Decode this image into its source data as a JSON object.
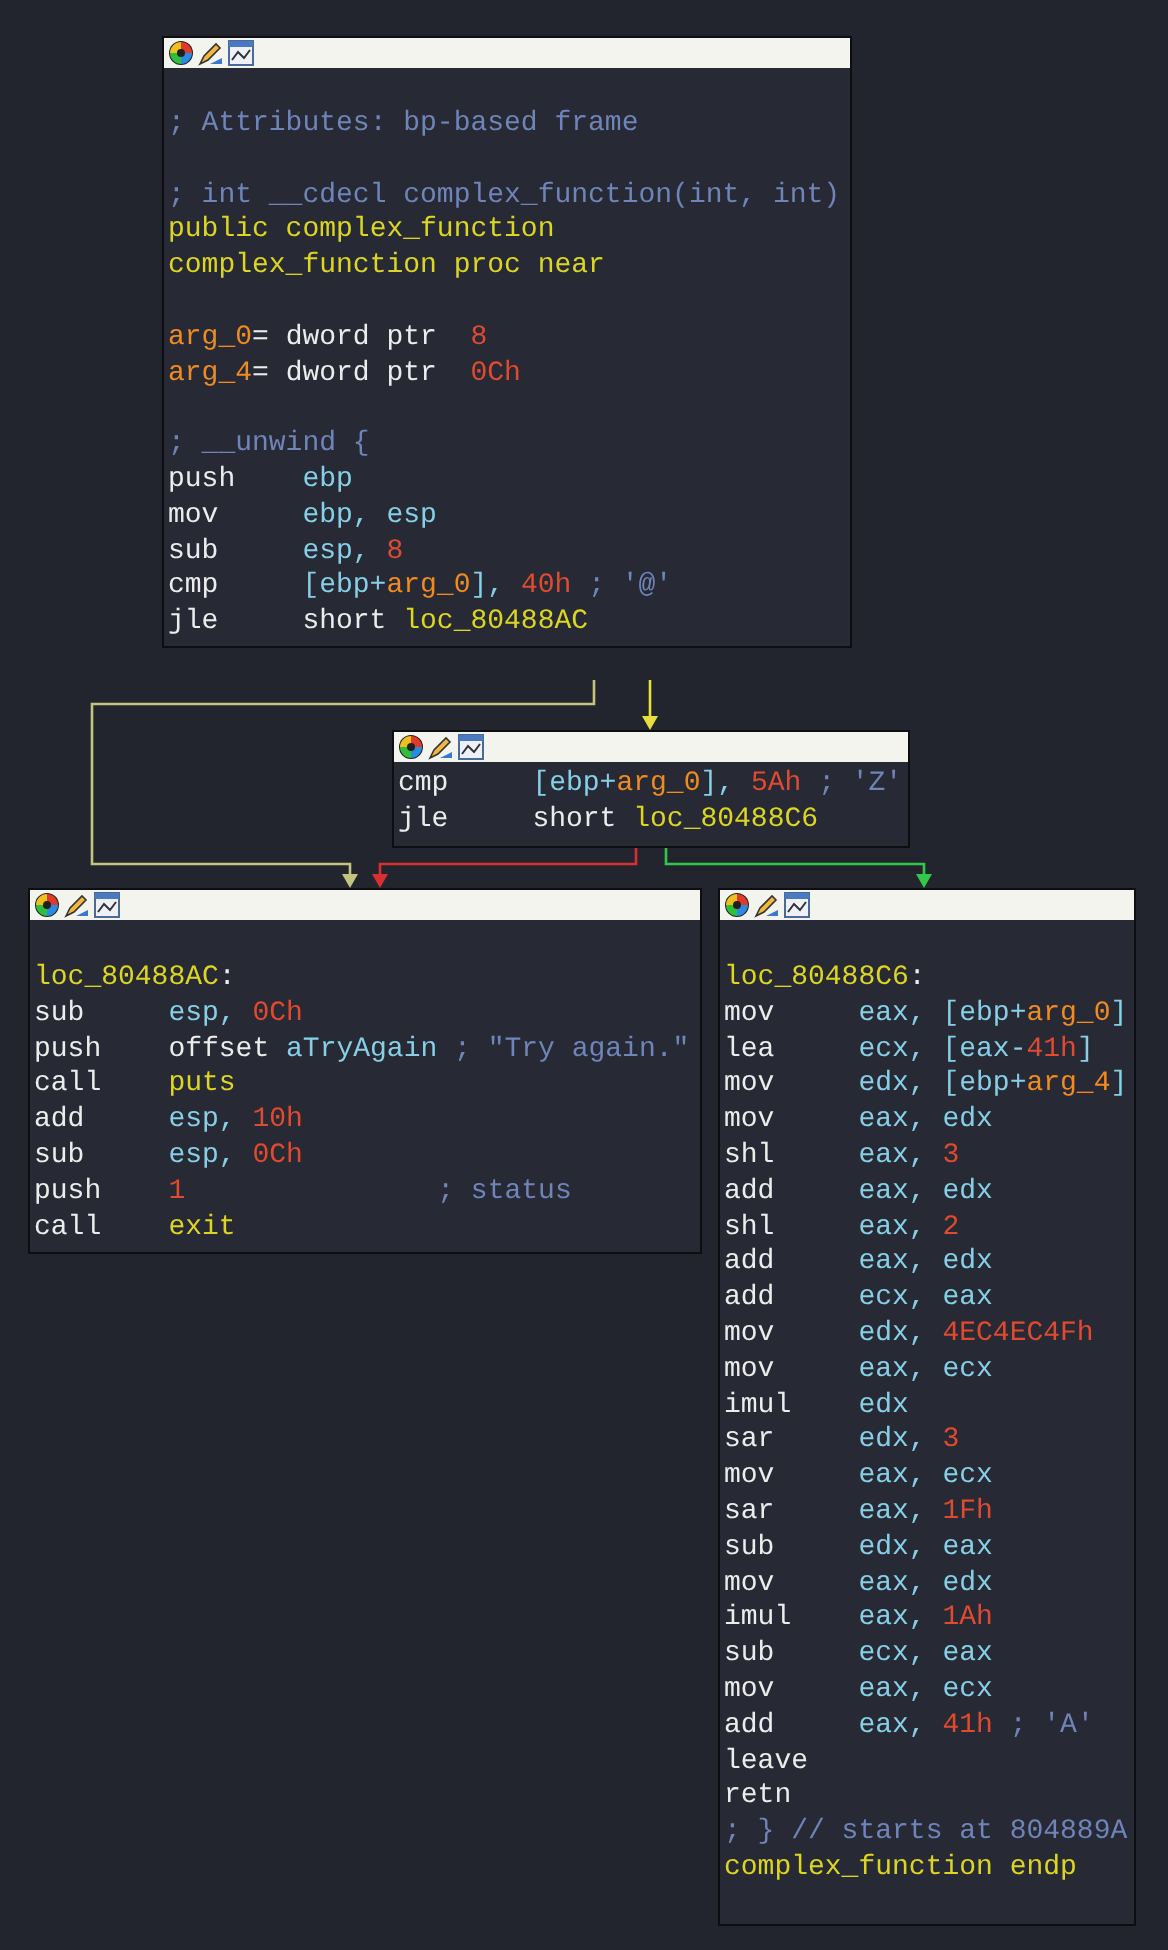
{
  "blocks": [
    {
      "sections": [
        [
          [
            {
              "kind": "comment",
              "text": "; Attributes: bp-based frame"
            }
          ]
        ],
        [
          [
            {
              "kind": "comment",
              "text": "; int __cdecl complex_function(int, int)"
            }
          ],
          [
            {
              "kind": "name",
              "text": "public complex_function"
            }
          ],
          [
            {
              "kind": "name",
              "text": "complex_function proc near"
            }
          ]
        ],
        [
          [
            {
              "kind": "var",
              "text": "arg_0"
            },
            {
              "kind": "plain",
              "text": "= dword ptr  "
            },
            {
              "kind": "number",
              "text": "8"
            }
          ],
          [
            {
              "kind": "var",
              "text": "arg_4"
            },
            {
              "kind": "plain",
              "text": "= dword ptr  "
            },
            {
              "kind": "number",
              "text": "0Ch"
            }
          ]
        ],
        [
          [
            {
              "kind": "comment",
              "text": "; __unwind {"
            }
          ],
          [
            {
              "kind": "mnemonic",
              "text": "push"
            },
            {
              "kind": "register",
              "text": "ebp"
            }
          ],
          [
            {
              "kind": "mnemonic",
              "text": "mov"
            },
            {
              "kind": "register",
              "text": "ebp, esp"
            }
          ],
          [
            {
              "kind": "mnemonic",
              "text": "sub"
            },
            {
              "kind": "register",
              "text": "esp, "
            },
            {
              "kind": "number",
              "text": "8"
            }
          ],
          [
            {
              "kind": "mnemonic",
              "text": "cmp"
            },
            {
              "kind": "register",
              "text": "[ebp+"
            },
            {
              "kind": "var",
              "text": "arg_0"
            },
            {
              "kind": "register",
              "text": "], "
            },
            {
              "kind": "number",
              "text": "40h"
            },
            {
              "kind": "comment",
              "text": " ; '@'"
            }
          ],
          [
            {
              "kind": "mnemonic",
              "text": "jle"
            },
            {
              "kind": "plain",
              "text": "short "
            },
            {
              "kind": "name",
              "text": "loc_80488AC"
            }
          ]
        ]
      ]
    },
    {
      "sections": [
        [
          [
            {
              "kind": "mnemonic",
              "text": "cmp"
            },
            {
              "kind": "register",
              "text": "[ebp+"
            },
            {
              "kind": "var",
              "text": "arg_0"
            },
            {
              "kind": "register",
              "text": "], "
            },
            {
              "kind": "number",
              "text": "5Ah"
            },
            {
              "kind": "comment",
              "text": " ; 'Z'"
            }
          ],
          [
            {
              "kind": "mnemonic",
              "text": "jle"
            },
            {
              "kind": "plain",
              "text": "short "
            },
            {
              "kind": "name",
              "text": "loc_80488C6"
            }
          ]
        ]
      ]
    },
    {
      "sections": [
        [
          [
            {
              "kind": "name",
              "text": "loc_80488AC"
            },
            {
              "kind": "plain",
              "text": ":"
            }
          ],
          [
            {
              "kind": "mnemonic",
              "text": "sub"
            },
            {
              "kind": "register",
              "text": "esp, "
            },
            {
              "kind": "number",
              "text": "0Ch"
            }
          ],
          [
            {
              "kind": "mnemonic",
              "text": "push"
            },
            {
              "kind": "plain",
              "text": "offset "
            },
            {
              "kind": "register",
              "text": "aTryAgain"
            },
            {
              "kind": "comment",
              "text": " ; \"Try again.\""
            }
          ],
          [
            {
              "kind": "mnemonic",
              "text": "call"
            },
            {
              "kind": "name",
              "text": "puts"
            }
          ],
          [
            {
              "kind": "mnemonic",
              "text": "add"
            },
            {
              "kind": "register",
              "text": "esp, "
            },
            {
              "kind": "number",
              "text": "10h"
            }
          ],
          [
            {
              "kind": "mnemonic",
              "text": "sub"
            },
            {
              "kind": "register",
              "text": "esp, "
            },
            {
              "kind": "number",
              "text": "0Ch"
            }
          ],
          [
            {
              "kind": "mnemonic",
              "text": "push"
            },
            {
              "kind": "number",
              "text": "1"
            },
            {
              "kind": "comment",
              "text": "               ; status"
            }
          ],
          [
            {
              "kind": "mnemonic",
              "text": "call"
            },
            {
              "kind": "name",
              "text": "exit"
            }
          ]
        ]
      ]
    },
    {
      "sections": [
        [
          [
            {
              "kind": "name",
              "text": "loc_80488C6"
            },
            {
              "kind": "plain",
              "text": ":"
            }
          ],
          [
            {
              "kind": "mnemonic",
              "text": "mov"
            },
            {
              "kind": "register",
              "text": "eax, [ebp+"
            },
            {
              "kind": "var",
              "text": "arg_0"
            },
            {
              "kind": "register",
              "text": "]"
            }
          ],
          [
            {
              "kind": "mnemonic",
              "text": "lea"
            },
            {
              "kind": "register",
              "text": "ecx, [eax-"
            },
            {
              "kind": "number",
              "text": "41h"
            },
            {
              "kind": "register",
              "text": "]"
            }
          ],
          [
            {
              "kind": "mnemonic",
              "text": "mov"
            },
            {
              "kind": "register",
              "text": "edx, [ebp+"
            },
            {
              "kind": "var",
              "text": "arg_4"
            },
            {
              "kind": "register",
              "text": "]"
            }
          ],
          [
            {
              "kind": "mnemonic",
              "text": "mov"
            },
            {
              "kind": "register",
              "text": "eax, edx"
            }
          ],
          [
            {
              "kind": "mnemonic",
              "text": "shl"
            },
            {
              "kind": "register",
              "text": "eax, "
            },
            {
              "kind": "number",
              "text": "3"
            }
          ],
          [
            {
              "kind": "mnemonic",
              "text": "add"
            },
            {
              "kind": "register",
              "text": "eax, edx"
            }
          ],
          [
            {
              "kind": "mnemonic",
              "text": "shl"
            },
            {
              "kind": "register",
              "text": "eax, "
            },
            {
              "kind": "number",
              "text": "2"
            }
          ],
          [
            {
              "kind": "mnemonic",
              "text": "add"
            },
            {
              "kind": "register",
              "text": "eax, edx"
            }
          ],
          [
            {
              "kind": "mnemonic",
              "text": "add"
            },
            {
              "kind": "register",
              "text": "ecx, eax"
            }
          ],
          [
            {
              "kind": "mnemonic",
              "text": "mov"
            },
            {
              "kind": "register",
              "text": "edx, "
            },
            {
              "kind": "number",
              "text": "4EC4EC4Fh"
            }
          ],
          [
            {
              "kind": "mnemonic",
              "text": "mov"
            },
            {
              "kind": "register",
              "text": "eax, ecx"
            }
          ],
          [
            {
              "kind": "mnemonic",
              "text": "imul"
            },
            {
              "kind": "register",
              "text": "edx"
            }
          ],
          [
            {
              "kind": "mnemonic",
              "text": "sar"
            },
            {
              "kind": "register",
              "text": "edx, "
            },
            {
              "kind": "number",
              "text": "3"
            }
          ],
          [
            {
              "kind": "mnemonic",
              "text": "mov"
            },
            {
              "kind": "register",
              "text": "eax, ecx"
            }
          ],
          [
            {
              "kind": "mnemonic",
              "text": "sar"
            },
            {
              "kind": "register",
              "text": "eax, "
            },
            {
              "kind": "number",
              "text": "1Fh"
            }
          ],
          [
            {
              "kind": "mnemonic",
              "text": "sub"
            },
            {
              "kind": "register",
              "text": "edx, eax"
            }
          ],
          [
            {
              "kind": "mnemonic",
              "text": "mov"
            },
            {
              "kind": "register",
              "text": "eax, edx"
            }
          ],
          [
            {
              "kind": "mnemonic",
              "text": "imul"
            },
            {
              "kind": "register",
              "text": "eax, "
            },
            {
              "kind": "number",
              "text": "1Ah"
            }
          ],
          [
            {
              "kind": "mnemonic",
              "text": "sub"
            },
            {
              "kind": "register",
              "text": "ecx, eax"
            }
          ],
          [
            {
              "kind": "mnemonic",
              "text": "mov"
            },
            {
              "kind": "register",
              "text": "eax, ecx"
            }
          ],
          [
            {
              "kind": "mnemonic",
              "text": "add"
            },
            {
              "kind": "register",
              "text": "eax, "
            },
            {
              "kind": "number",
              "text": "41h"
            },
            {
              "kind": "comment",
              "text": " ; 'A'"
            }
          ],
          [
            {
              "kind": "plain",
              "text": "leave"
            }
          ],
          [
            {
              "kind": "plain",
              "text": "retn"
            }
          ],
          [
            {
              "kind": "comment",
              "text": "; } // starts at 804889A"
            }
          ],
          [
            {
              "kind": "name",
              "text": "complex_function endp"
            }
          ]
        ]
      ]
    }
  ],
  "edges": [
    {
      "color": "#c4c47e"
    },
    {
      "color": "#e8e03a"
    },
    {
      "color": "#d83030"
    },
    {
      "color": "#34c84a"
    }
  ]
}
